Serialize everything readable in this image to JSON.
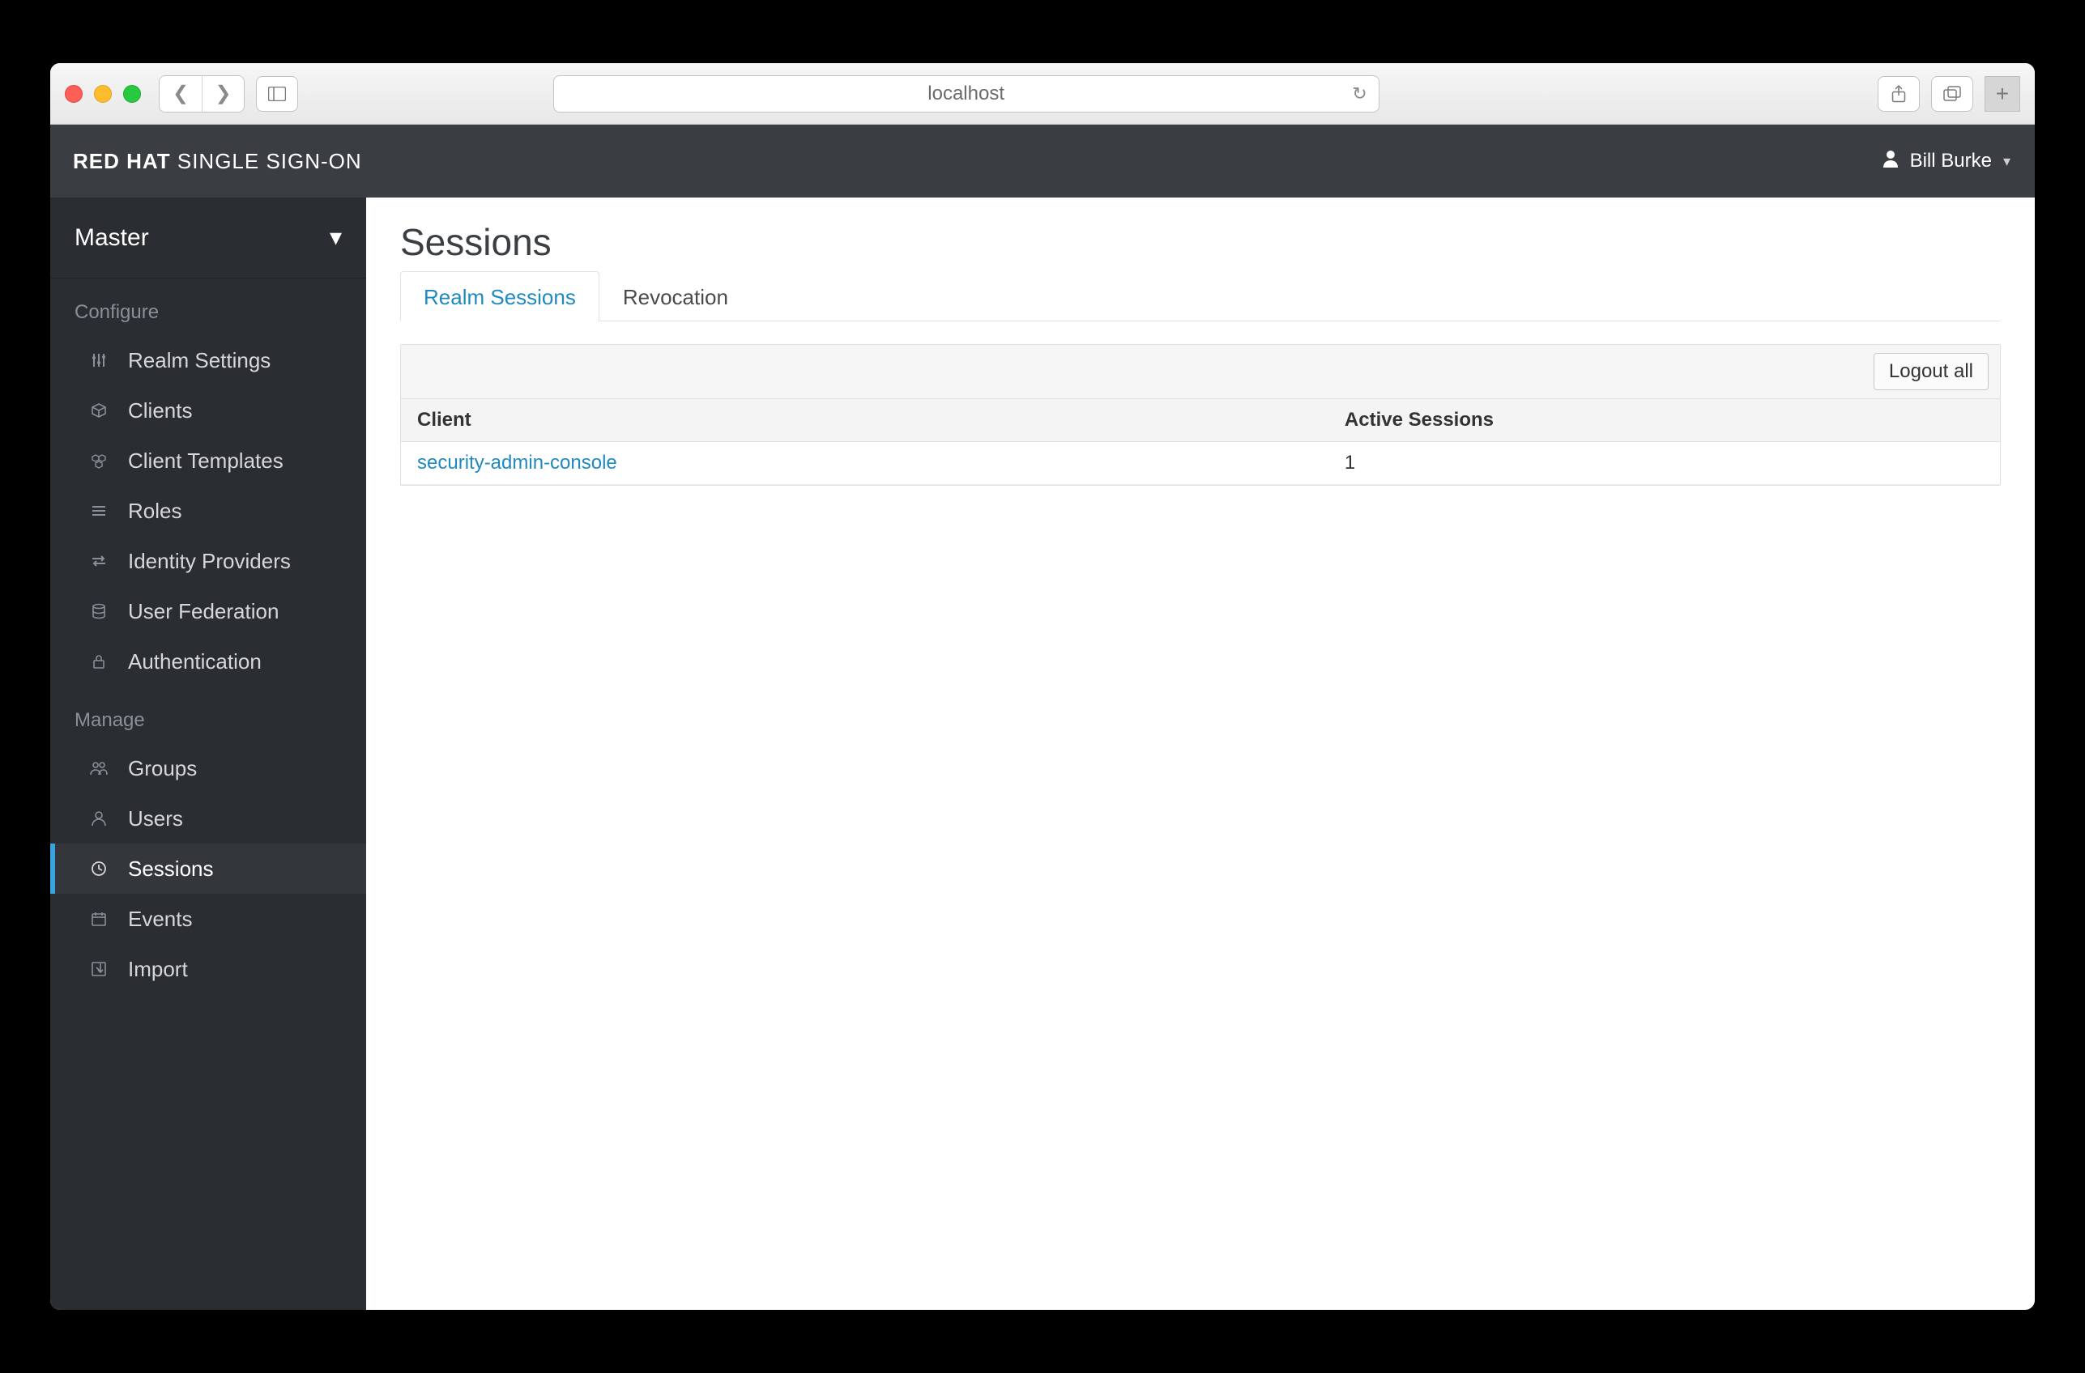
{
  "browser": {
    "url": "localhost"
  },
  "header": {
    "brand_bold": "RED HAT",
    "brand_light": "SINGLE SIGN-ON",
    "user": "Bill Burke"
  },
  "sidebar": {
    "realm": "Master",
    "sections": {
      "configure": {
        "label": "Configure",
        "items": [
          {
            "label": "Realm Settings"
          },
          {
            "label": "Clients"
          },
          {
            "label": "Client Templates"
          },
          {
            "label": "Roles"
          },
          {
            "label": "Identity Providers"
          },
          {
            "label": "User Federation"
          },
          {
            "label": "Authentication"
          }
        ]
      },
      "manage": {
        "label": "Manage",
        "items": [
          {
            "label": "Groups"
          },
          {
            "label": "Users"
          },
          {
            "label": "Sessions"
          },
          {
            "label": "Events"
          },
          {
            "label": "Import"
          }
        ]
      }
    }
  },
  "main": {
    "title": "Sessions",
    "tabs": [
      {
        "label": "Realm Sessions"
      },
      {
        "label": "Revocation"
      }
    ],
    "toolbar": {
      "logout_all": "Logout all"
    },
    "table": {
      "headers": {
        "client": "Client",
        "active": "Active Sessions"
      },
      "rows": [
        {
          "client": "security-admin-console",
          "active": "1"
        }
      ]
    }
  }
}
